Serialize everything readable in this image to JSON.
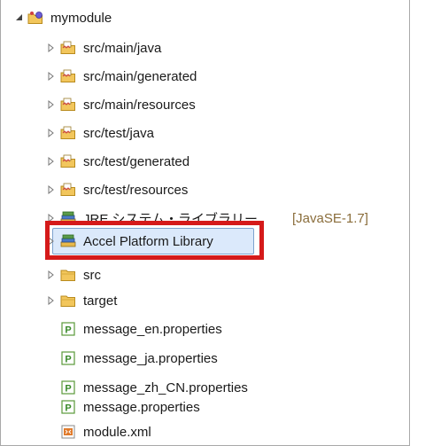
{
  "tree": {
    "project": {
      "label": "mymodule",
      "icon": "project-folder-icon"
    },
    "items": [
      {
        "label": "src/main/java",
        "icon": "source-folder-icon"
      },
      {
        "label": "src/main/generated",
        "icon": "source-folder-icon"
      },
      {
        "label": "src/main/resources",
        "icon": "source-folder-icon"
      },
      {
        "label": "src/test/java",
        "icon": "source-folder-icon"
      },
      {
        "label": "src/test/generated",
        "icon": "source-folder-icon"
      },
      {
        "label": "src/test/resources",
        "icon": "source-folder-icon"
      },
      {
        "label": "JRE システム・ライブラリー",
        "decoration": "[JavaSE-1.7]",
        "icon": "library-icon"
      },
      {
        "label": "Accel Platform Library",
        "icon": "library-icon",
        "selected": true
      },
      {
        "label": "src",
        "icon": "folder-icon"
      },
      {
        "label": "target",
        "icon": "folder-icon"
      },
      {
        "label": "message_en.properties",
        "icon": "properties-file-icon"
      },
      {
        "label": "message_ja.properties",
        "icon": "properties-file-icon"
      },
      {
        "label": "message_zh_CN.properties",
        "icon": "properties-file-icon"
      },
      {
        "label": "message.properties",
        "icon": "properties-file-icon"
      },
      {
        "label": "module.xml",
        "icon": "xml-file-icon"
      }
    ]
  },
  "colors": {
    "highlight_border": "#d51a1a",
    "selection_bg": "#dbe9fb",
    "selection_border": "#7da2ce",
    "decoration_text": "#8a6d3b"
  }
}
